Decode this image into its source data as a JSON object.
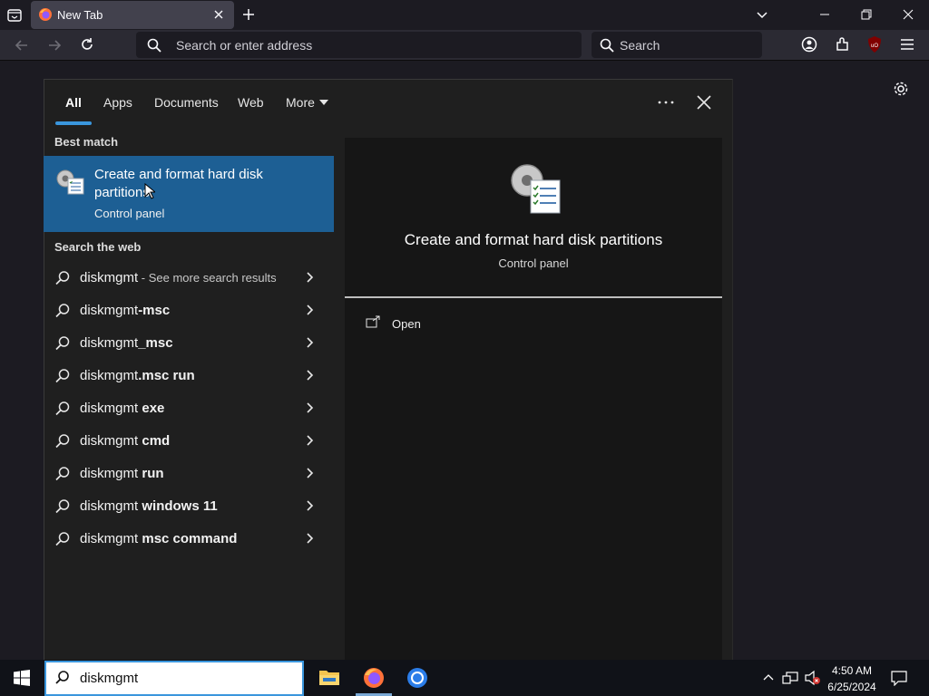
{
  "browser": {
    "tab_title": "New Tab",
    "url_placeholder": "Search or enter address",
    "search_placeholder": "Search"
  },
  "panel": {
    "filter_tabs": [
      "All",
      "Apps",
      "Documents",
      "Web",
      "More"
    ],
    "best_match_heading": "Best match",
    "best_match": {
      "title": "Create and format hard disk partitions",
      "subtitle": "Control panel"
    },
    "search_web_heading": "Search the web",
    "web_results": [
      {
        "prefix": "diskmgmt",
        "suffix": "",
        "extra": " - See more search results"
      },
      {
        "prefix": "diskmgmt",
        "suffix": "-msc",
        "extra": ""
      },
      {
        "prefix": "diskmgmt",
        "suffix": "_msc",
        "extra": ""
      },
      {
        "prefix": "diskmgmt",
        "suffix": ".msc run",
        "extra": ""
      },
      {
        "prefix": "diskmgmt",
        "suffix": " exe",
        "extra": ""
      },
      {
        "prefix": "diskmgmt",
        "suffix": " cmd",
        "extra": ""
      },
      {
        "prefix": "diskmgmt",
        "suffix": " run",
        "extra": ""
      },
      {
        "prefix": "diskmgmt",
        "suffix": " windows 11",
        "extra": ""
      },
      {
        "prefix": "diskmgmt",
        "suffix": " msc command",
        "extra": ""
      }
    ],
    "preview": {
      "title": "Create and format hard disk partitions",
      "subtitle": "Control panel",
      "open_label": "Open"
    }
  },
  "taskbar": {
    "search_value": "diskmgmt",
    "time": "4:50 AM",
    "date": "6/25/2024"
  },
  "colors": {
    "accent": "#1d5f94",
    "tab_indicator": "#3a96dd"
  }
}
